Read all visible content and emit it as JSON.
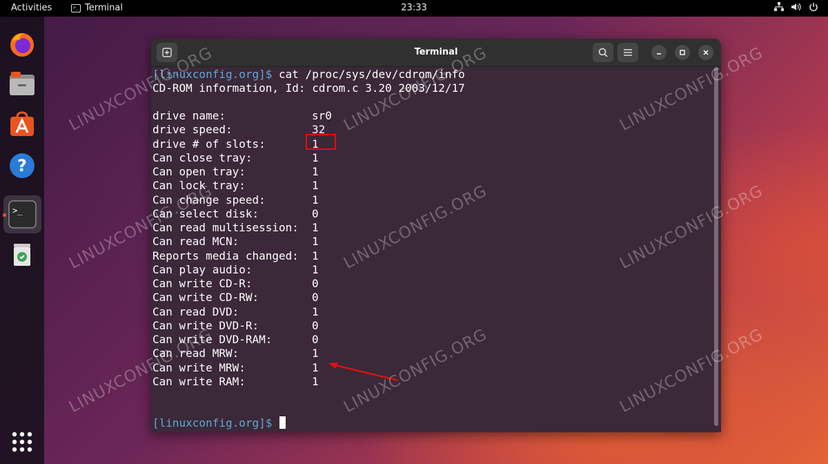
{
  "topbar": {
    "activities": "Activities",
    "app_name": "Terminal",
    "clock": "23:33",
    "tray_icons": [
      "network-icon",
      "volume-icon",
      "power-icon"
    ]
  },
  "dock": {
    "items": [
      "firefox-icon",
      "files-icon",
      "app-center-icon",
      "help-icon",
      "terminal-icon",
      "trash-icon",
      "show-apps-icon"
    ],
    "active": "terminal-icon"
  },
  "window": {
    "title": "Terminal",
    "new_tab_icon": "new-tab-icon",
    "search_icon": "search-icon",
    "menu_icon": "hamburger-menu-icon"
  },
  "terminal": {
    "prompt": "[linuxconfig.org]$",
    "command": " cat /proc/sys/dev/cdrom/info",
    "header": "CD-ROM information, Id: cdrom.c 3.20 2003/12/17",
    "rows": [
      {
        "label": "drive name:",
        "value": "sr0"
      },
      {
        "label": "drive speed:",
        "value": "32"
      },
      {
        "label": "drive # of slots:",
        "value": "1"
      },
      {
        "label": "Can close tray:",
        "value": "1"
      },
      {
        "label": "Can open tray:",
        "value": "1"
      },
      {
        "label": "Can lock tray:",
        "value": "1"
      },
      {
        "label": "Can change speed:",
        "value": "1"
      },
      {
        "label": "Can select disk:",
        "value": "0"
      },
      {
        "label": "Can read multisession:",
        "value": "1"
      },
      {
        "label": "Can read MCN:",
        "value": "1"
      },
      {
        "label": "Reports media changed:",
        "value": "1"
      },
      {
        "label": "Can play audio:",
        "value": "1"
      },
      {
        "label": "Can write CD-R:",
        "value": "0"
      },
      {
        "label": "Can write CD-RW:",
        "value": "0"
      },
      {
        "label": "Can read DVD:",
        "value": "1"
      },
      {
        "label": "Can write DVD-R:",
        "value": "0"
      },
      {
        "label": "Can write DVD-RAM:",
        "value": "0"
      },
      {
        "label": "Can read MRW:",
        "value": "1"
      },
      {
        "label": "Can write MRW:",
        "value": "1"
      },
      {
        "label": "Can write RAM:",
        "value": "1"
      }
    ],
    "final_prompt": "[linuxconfig.org]$"
  },
  "watermark": "LINUXCONFIG.ORG",
  "colors": {
    "prompt": "#5fa8d3",
    "highlight": "#e01010",
    "ubuntu_orange": "#e95420"
  }
}
